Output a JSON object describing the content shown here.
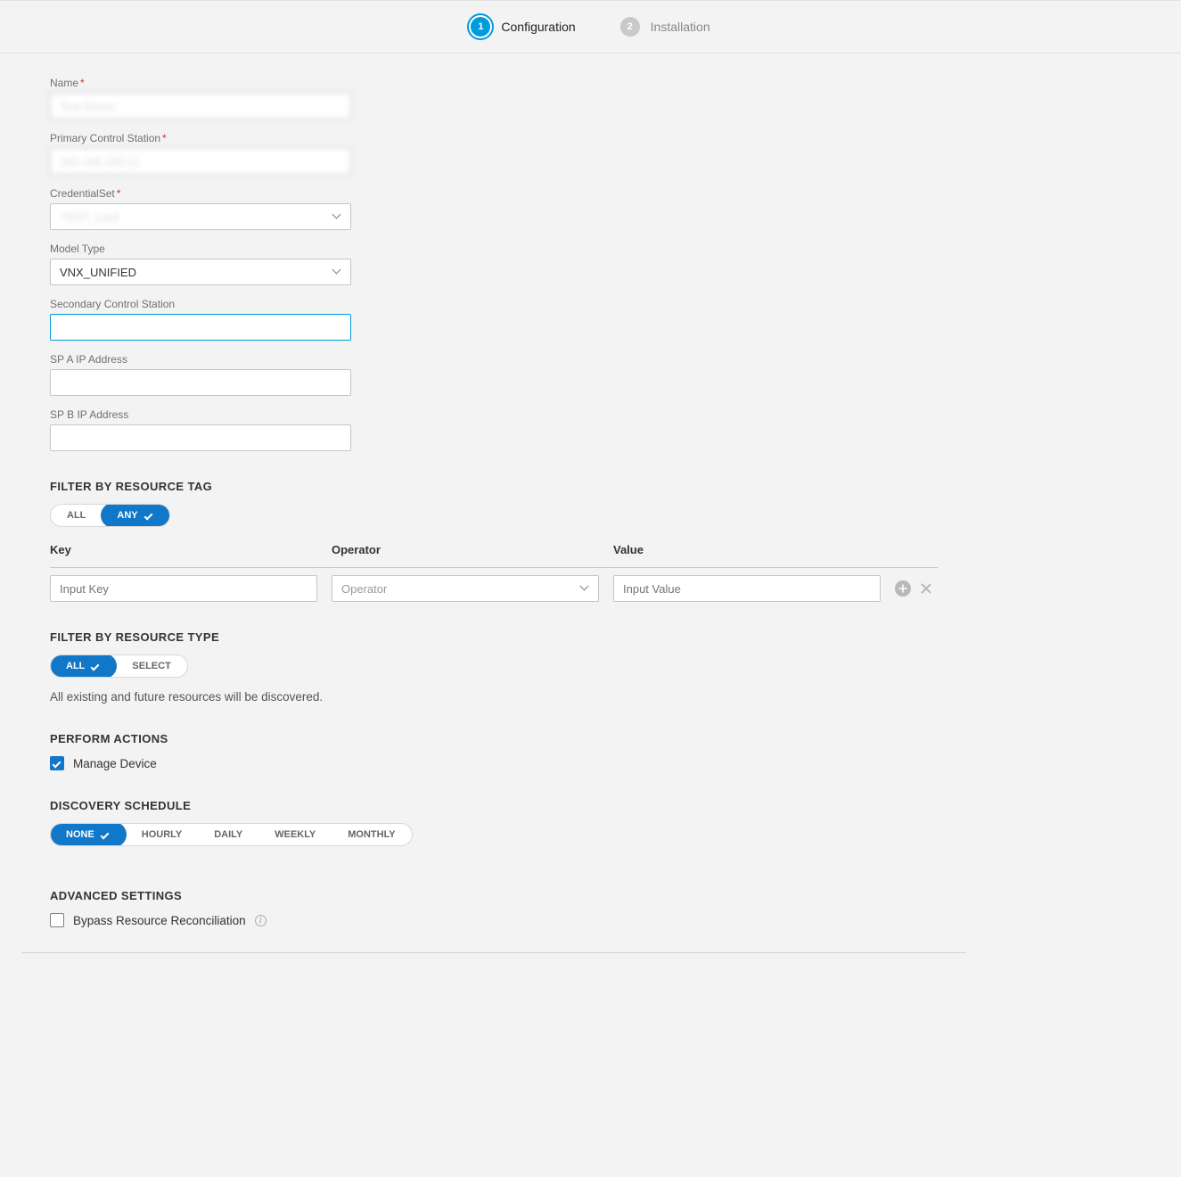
{
  "wizard": {
    "step1": {
      "num": "1",
      "label": "Configuration"
    },
    "step2": {
      "num": "2",
      "label": "Installation"
    }
  },
  "fields": {
    "name": {
      "label": "Name",
      "value": "Test Demo"
    },
    "primary": {
      "label": "Primary Control Station",
      "value": "192.168.190.11"
    },
    "credset": {
      "label": "CredentialSet",
      "value": "TEST_cred"
    },
    "modeltype": {
      "label": "Model Type",
      "value": "VNX_UNIFIED"
    },
    "secondary": {
      "label": "Secondary Control Station",
      "value": ""
    },
    "spa": {
      "label": "SP A IP Address",
      "value": ""
    },
    "spb": {
      "label": "SP B IP Address",
      "value": ""
    }
  },
  "filter_tag": {
    "title": "FILTER BY RESOURCE TAG",
    "opt_all": "ALL",
    "opt_any": "ANY",
    "head_key": "Key",
    "head_op": "Operator",
    "head_val": "Value",
    "ph_key": "Input Key",
    "ph_op": "Operator",
    "ph_val": "Input Value"
  },
  "filter_type": {
    "title": "FILTER BY RESOURCE TYPE",
    "opt_all": "ALL",
    "opt_select": "SELECT",
    "hint": "All existing and future resources will be discovered."
  },
  "actions": {
    "title": "PERFORM ACTIONS",
    "manage": "Manage Device"
  },
  "schedule": {
    "title": "DISCOVERY SCHEDULE",
    "opt_none": "NONE",
    "opt_hourly": "HOURLY",
    "opt_daily": "DAILY",
    "opt_weekly": "WEEKLY",
    "opt_monthly": "MONTHLY"
  },
  "advanced": {
    "title": "ADVANCED SETTINGS",
    "bypass": "Bypass Resource Reconciliation"
  }
}
